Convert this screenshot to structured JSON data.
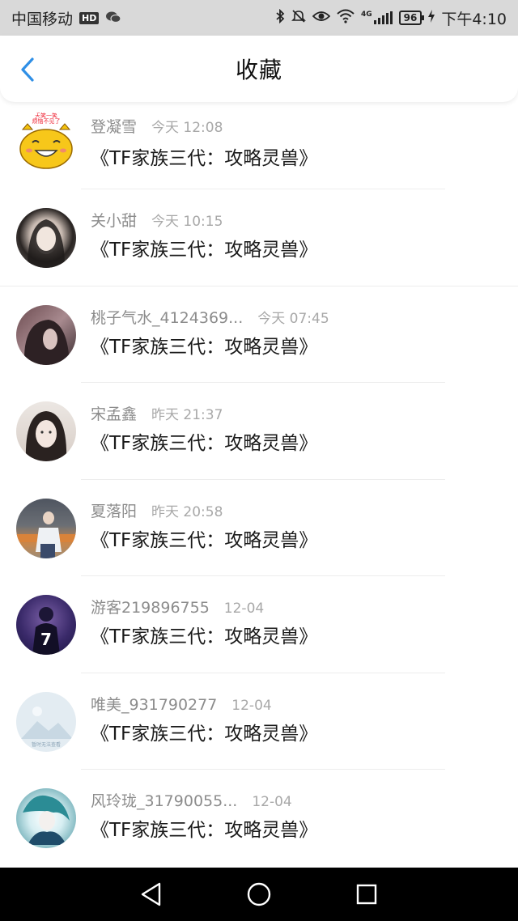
{
  "status_bar": {
    "carrier": "中国移动",
    "hd": "HD",
    "network": "4G",
    "battery": "96",
    "time": "下午4:10",
    "icons": [
      "wechat-icon",
      "bluetooth-icon",
      "mute-icon",
      "eye-icon",
      "wifi-icon",
      "signal-icon",
      "battery-icon",
      "charging-icon"
    ]
  },
  "header": {
    "title": "收藏",
    "back_icon": "back-chevron-icon"
  },
  "items": [
    {
      "username": "登凝雪",
      "time": "今天 12:08",
      "content": "《TF家族三代：攻略灵兽》",
      "avatar_text": "天笑一笑 烦恼不见了"
    },
    {
      "username": "关小甜",
      "time": "今天 10:15",
      "content": "《TF家族三代：攻略灵兽》"
    },
    {
      "username": "桃子气水_4124369...",
      "time": "今天 07:45",
      "content": "《TF家族三代：攻略灵兽》"
    },
    {
      "username": "宋孟鑫",
      "time": "昨天 21:37",
      "content": "《TF家族三代：攻略灵兽》"
    },
    {
      "username": "夏落阳",
      "time": "昨天 20:58",
      "content": "《TF家族三代：攻略灵兽》"
    },
    {
      "username": "游客219896755",
      "time": "12-04",
      "content": "《TF家族三代：攻略灵兽》",
      "avatar_text": "7"
    },
    {
      "username": "唯美_931790277",
      "time": "12-04",
      "content": "《TF家族三代：攻略灵兽》",
      "avatar_text": "暂时无法查看"
    },
    {
      "username": "风玲珑_31790055...",
      "time": "12-04",
      "content": "《TF家族三代：攻略灵兽》"
    }
  ],
  "nav": {
    "back": "nav-back-icon",
    "home": "nav-home-icon",
    "recents": "nav-recents-icon"
  },
  "colors": {
    "accent": "#2f8fe6",
    "username": "#8c8c8c",
    "time": "#a8a8a8",
    "status_bar_bg": "#d9d9d9",
    "nav_bg": "#000000"
  }
}
